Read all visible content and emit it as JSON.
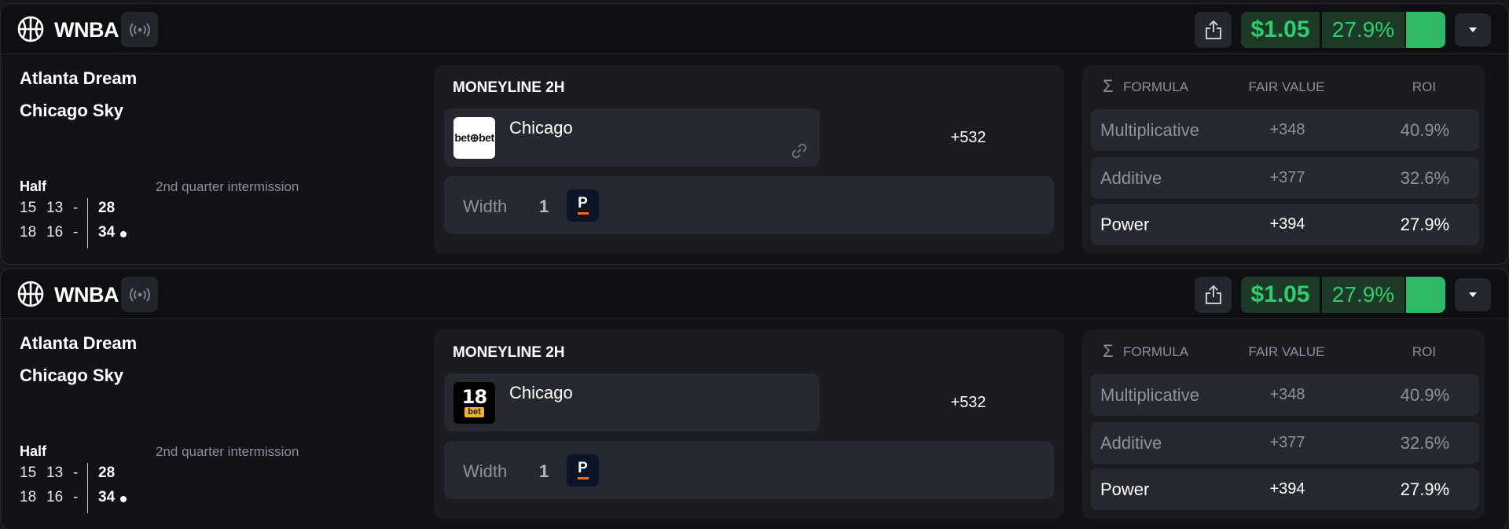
{
  "cards": [
    {
      "league": "WNBA",
      "league_icon": "basketball-icon",
      "price": "$1.05",
      "roi": "27.9%",
      "teams": [
        "Atlanta Dream",
        "Chicago Sky"
      ],
      "period_label": "Half",
      "status": "2nd quarter intermission",
      "scores": [
        {
          "q1": "15",
          "q2": "13",
          "sep": "-",
          "total": "28",
          "possession": false
        },
        {
          "q1": "18",
          "q2": "16",
          "sep": "-",
          "total": "34",
          "possession": true
        }
      ],
      "market": {
        "title": "MONEYLINE 2H",
        "bookmaker_logo_text": "bet⊕bet",
        "selection": "Chicago",
        "odds": "+532",
        "width_label": "Width",
        "width_value": "1",
        "sharp_book_logo": "P"
      },
      "formula": {
        "headers": [
          "FORMULA",
          "FAIR VALUE",
          "ROI"
        ],
        "rows": [
          {
            "name": "Multiplicative",
            "fair_value": "+348",
            "roi": "40.9%"
          },
          {
            "name": "Additive",
            "fair_value": "+377",
            "roi": "32.6%"
          },
          {
            "name": "Power",
            "fair_value": "+394",
            "roi": "27.9%"
          }
        ]
      }
    },
    {
      "league": "WNBA",
      "league_icon": "basketball-icon",
      "price": "$1.05",
      "roi": "27.9%",
      "teams": [
        "Atlanta Dream",
        "Chicago Sky"
      ],
      "period_label": "Half",
      "status": "2nd quarter intermission",
      "scores": [
        {
          "q1": "15",
          "q2": "13",
          "sep": "-",
          "total": "28",
          "possession": false
        },
        {
          "q1": "18",
          "q2": "16",
          "sep": "-",
          "total": "34",
          "possession": true
        }
      ],
      "market": {
        "title": "MONEYLINE 2H",
        "bookmaker_logo_text": "18",
        "bookmaker_logo_subtext": "bet",
        "selection": "Chicago",
        "odds": "+532",
        "width_label": "Width",
        "width_value": "1",
        "sharp_book_logo": "P"
      },
      "formula": {
        "headers": [
          "FORMULA",
          "FAIR VALUE",
          "ROI"
        ],
        "rows": [
          {
            "name": "Multiplicative",
            "fair_value": "+348",
            "roi": "40.9%"
          },
          {
            "name": "Additive",
            "fair_value": "+377",
            "roi": "32.6%"
          },
          {
            "name": "Power",
            "fair_value": "+394",
            "roi": "27.9%"
          }
        ]
      }
    }
  ],
  "colors": {
    "accent_green": "#2fce6c",
    "green_bg": "#1d3a29",
    "button_green": "#30b865",
    "card_bg": "#111318",
    "panel_bg": "#1a1c22",
    "row_bg": "#26292f"
  }
}
